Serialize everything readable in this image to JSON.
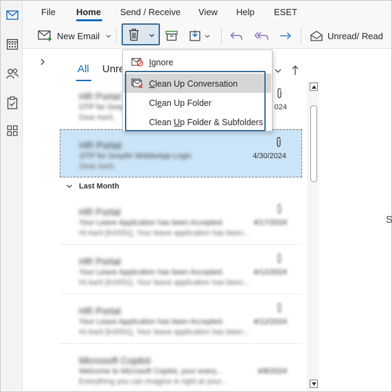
{
  "tabs": [
    "File",
    "Home",
    "Send / Receive",
    "View",
    "Help",
    "ESET"
  ],
  "ribbon": {
    "new_email": "New Email",
    "unread_read": "Unread/ Read"
  },
  "filter": {
    "all": "All",
    "unread": "Unre"
  },
  "delete_menu": {
    "items": [
      {
        "label": "Ignore",
        "hotkey": "I"
      },
      {
        "label": "Clean Up Conversation",
        "hotkey": "C"
      },
      {
        "label": "Clean Up Folder",
        "hotkey": "e"
      },
      {
        "label": "Clean Up Folder & Subfolders",
        "hotkey": "U"
      }
    ]
  },
  "list": {
    "first_partial": {
      "sender": "HR Portal",
      "subject": "OTP for Greyt",
      "preview": "Dear Aarti,",
      "date": "024"
    },
    "selected": {
      "sender": "HR Portal",
      "subject": "OTP for Greythr MobileApp Login",
      "preview": "Dear Aarti,",
      "date": "4/30/2024"
    },
    "group_title": "Last Month",
    "items": [
      {
        "sender": "HR Portal",
        "subject": "Your Leave Application has been Accepted.",
        "preview": "Hi Aarti [KA591], Your leave application has been...",
        "date": "4/17/2024"
      },
      {
        "sender": "HR Portal",
        "subject": "Your Leave Application has been Accepted.",
        "preview": "Hi Aarti [KA591], Your leave application has been...",
        "date": "4/12/2024"
      },
      {
        "sender": "HR Portal",
        "subject": "Your Leave Application has been Accepted.",
        "preview": "Hi Aarti [KA591], Your leave application has been...",
        "date": "4/12/2024"
      },
      {
        "sender": "Microsoft Copilot",
        "subject": "Welcome to Microsoft Copilot, your every...",
        "preview": "Everything you can imagine is right at your...",
        "date": "4/8/2024"
      }
    ]
  },
  "reading_pane_char": "S",
  "colors": {
    "accent": "#0f6cbd",
    "selection": "#cce4f7",
    "focus_border": "#3c6e96",
    "hover": "#d6d6d6"
  }
}
